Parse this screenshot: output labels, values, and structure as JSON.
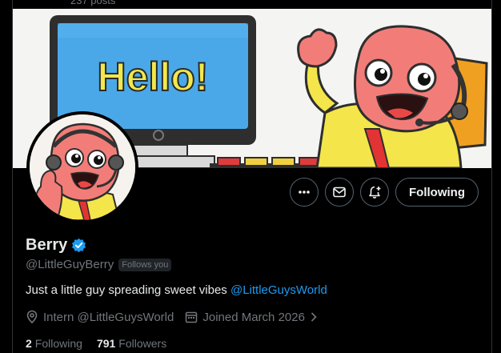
{
  "header": {
    "post_count": "237 posts"
  },
  "banner": {
    "screen_text": "Hello!"
  },
  "actions": {
    "more_icon": "more-horizontal-icon",
    "message_icon": "envelope-icon",
    "notify_icon": "bell-plus-icon",
    "following_label": "Following"
  },
  "profile": {
    "name": "Berry",
    "verified_icon": "verified-badge-icon",
    "handle": "@LittleGuyBerry",
    "follows_you": "Follows you",
    "bio_text": "Just a little guy spreading sweet vibes ",
    "bio_mention": "@LittleGuysWorld",
    "job": "Intern @LittleGuysWorld",
    "joined": "Joined March 2026",
    "following_count": "2",
    "following_label": "Following",
    "followers_count": "791",
    "followers_label": "Followers"
  },
  "colors": {
    "accent": "#1d9bf0",
    "muted": "#71767b",
    "text": "#e7e9ea",
    "background": "#000000",
    "border": "#536471"
  }
}
